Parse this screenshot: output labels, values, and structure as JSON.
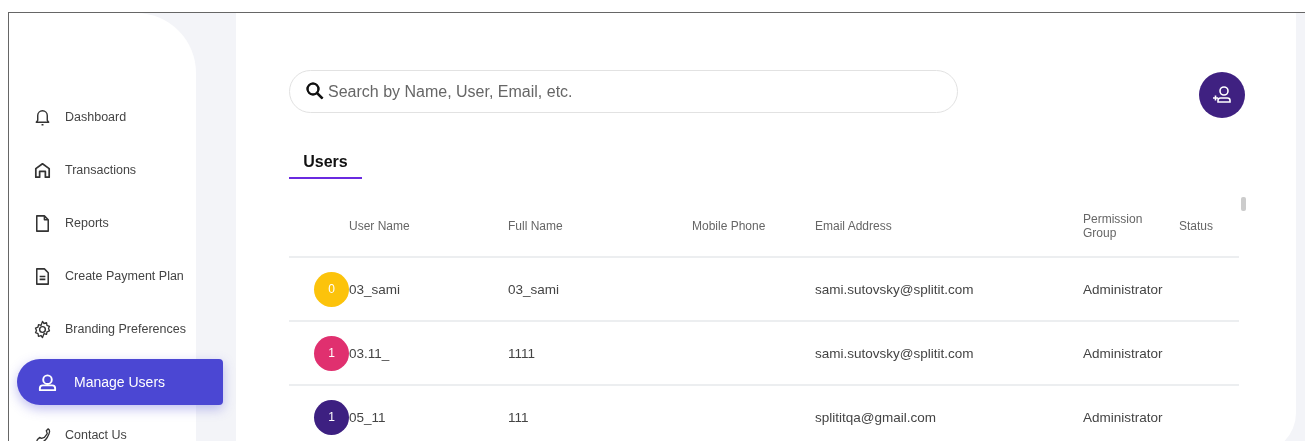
{
  "sidebar": {
    "items": [
      {
        "label": "Dashboard",
        "selected": false
      },
      {
        "label": "Transactions",
        "selected": false
      },
      {
        "label": "Reports",
        "selected": false
      },
      {
        "label": "Create Payment Plan",
        "selected": false
      },
      {
        "label": "Branding Preferences",
        "selected": false
      },
      {
        "label": "Manage Users",
        "selected": true
      },
      {
        "label": "Contact Us",
        "selected": false
      }
    ]
  },
  "search": {
    "placeholder": "Search by Name, User, Email, etc."
  },
  "tabs": [
    {
      "label": "Users",
      "selected": true
    }
  ],
  "table": {
    "columns": [
      "User Name",
      "Full Name",
      "Mobile Phone",
      "Email Address",
      "Permission Group",
      "Status"
    ],
    "rows": [
      {
        "avatar": "0",
        "color": "#fcc30b",
        "user_name": "03_sami",
        "full_name": "03_sami",
        "email": "sami.sutovsky@splitit.com",
        "permission_group": "Administrator"
      },
      {
        "avatar": "1",
        "color": "#e0306f",
        "user_name": "03.11_",
        "full_name": "1111",
        "email": "sami.sutovsky@splitit.com",
        "permission_group": "Administrator"
      },
      {
        "avatar": "1",
        "color": "#3d2081",
        "user_name": "05_11",
        "full_name": "111",
        "email": "splititqa@gmail.com",
        "permission_group": "Administrator"
      }
    ]
  }
}
